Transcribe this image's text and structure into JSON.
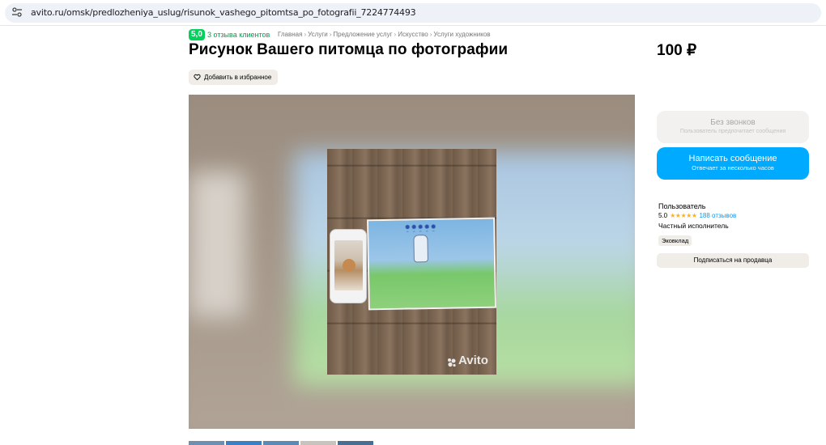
{
  "browser": {
    "url": "avito.ru/omsk/predlozheniya_uslug/risunok_vashego_pitomtsa_po_fotografii_7224774493"
  },
  "header": {
    "rating": "5,0",
    "reviews_link": "3 отзыва клиентов",
    "breadcrumbs": [
      "Главная",
      "Услуги",
      "Предложение услуг",
      "Искусство",
      "Услуги художников"
    ],
    "title": "Рисунок Вашего питомца по фотографии",
    "favorite_label": "Добавить в избранное"
  },
  "price": "100 ₽",
  "photo": {
    "watermark": "Avito"
  },
  "sidebar": {
    "no_calls_button": {
      "title": "Без звонков",
      "subtitle": "Пользователь предпочитает сообщения"
    },
    "message_button": {
      "title": "Написать сообщение",
      "subtitle": "Отвечает за несколько часов"
    },
    "seller": {
      "name": "Пользователь",
      "rating": "5.0",
      "stars": "★★★★★",
      "reviews": "188 отзывов",
      "kind": "Частный исполнитель",
      "badge": "Эковклад",
      "subscribe_label": "Подписаться на продавца"
    }
  },
  "colors": {
    "accent_blue": "#00aaff",
    "rating_green": "#02d15c",
    "link_green": "#00a046",
    "star_yellow": "#ffb021"
  },
  "thumbnails": [
    "#6e8fb0",
    "#3b7fc4",
    "#5a8ab8",
    "#c9c3bb",
    "#4a6d92"
  ]
}
